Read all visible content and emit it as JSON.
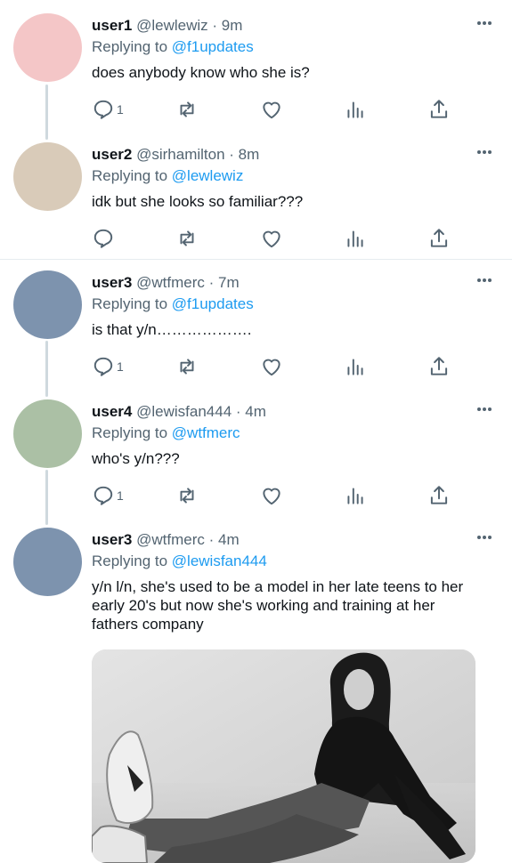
{
  "tweets": [
    {
      "username": "user1",
      "handle": "@lewlewiz",
      "time": "9m",
      "replying_prefix": "Replying to ",
      "replying_to": "@f1updates",
      "text": "does anybody know who she is?",
      "reply_count": "1",
      "avatar_color": "#f4c6c7"
    },
    {
      "username": "user2",
      "handle": "@sirhamilton",
      "time": "8m",
      "replying_prefix": "Replying to ",
      "replying_to": "@lewlewiz",
      "text": "idk but she looks so familiar???",
      "reply_count": "",
      "avatar_color": "#d9cbb9"
    },
    {
      "username": "user3",
      "handle": "@wtfmerc",
      "time": "7m",
      "replying_prefix": "Replying to ",
      "replying_to": "@f1updates",
      "text": "is that y/n……………….",
      "reply_count": "1",
      "avatar_color": "#7d93ae"
    },
    {
      "username": "user4",
      "handle": "@lewisfan444",
      "time": "4m",
      "replying_prefix": "Replying to ",
      "replying_to": "@wtfmerc",
      "text": "who's y/n???",
      "reply_count": "1",
      "avatar_color": "#abc0a5"
    },
    {
      "username": "user3",
      "handle": "@wtfmerc",
      "time": "4m",
      "replying_prefix": "Replying to ",
      "replying_to": "@lewisfan444",
      "text": "y/n l/n, she's used to be a model in her late teens to her early 20's but now she's working and training at her fathers company",
      "avatar_color": "#7d93ae"
    }
  ],
  "separator": " · ",
  "colors": {
    "link": "#1d9bf0",
    "secondary_text": "#536471",
    "thread_line": "#cfd9de"
  },
  "icons": [
    "reply-icon",
    "retweet-icon",
    "like-icon",
    "analytics-icon",
    "share-icon",
    "more-icon"
  ]
}
